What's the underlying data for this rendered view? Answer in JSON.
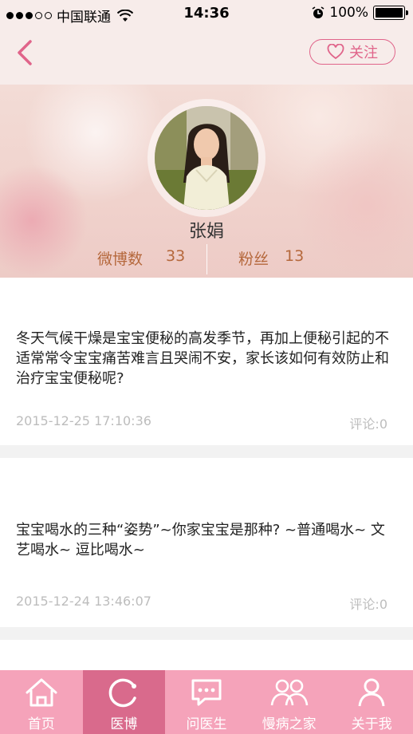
{
  "status_bar": {
    "carrier": "中国联通",
    "time": "14:36",
    "battery": "100%",
    "battery_level": 1.0,
    "signal_bars": 3,
    "signal_total": 5
  },
  "nav": {
    "back_icon": "chevron-left-icon",
    "follow_label": "关注",
    "follow_icon": "heart-outline-icon",
    "accent_color": "#e0648a"
  },
  "profile": {
    "name": "张娟",
    "weibo_label": "微博数",
    "weibo_count": "33",
    "fans_label": "粉丝",
    "fans_count": "13"
  },
  "posts": [
    {
      "text": "冬天气候干燥是宝宝便秘的高发季节，再加上便秘引起的不适常常令宝宝痛苦难言且哭闹不安，家长该如何有效防止和治疗宝宝便秘呢?",
      "time": "2015-12-25 17:10:36",
      "comments": "评论:0"
    },
    {
      "text": "宝宝喝水的三种“姿势”~你家宝宝是那种? ~普通喝水~ 文艺喝水~ 逗比喝水~",
      "time": "2015-12-24 13:46:07",
      "comments": "评论:0"
    }
  ],
  "tabs": [
    {
      "label": "首页",
      "icon": "home-icon",
      "active": false
    },
    {
      "label": "医博",
      "icon": "refresh-icon",
      "active": true
    },
    {
      "label": "问医生",
      "icon": "chat-bubble-icon",
      "active": false
    },
    {
      "label": "慢病之家",
      "icon": "group-icon",
      "active": false
    },
    {
      "label": "关于我",
      "icon": "person-icon",
      "active": false
    }
  ],
  "colors": {
    "tab_bar": "#f5a3ba",
    "tab_active": "#d96a8c",
    "stat_text": "#b5683c"
  }
}
